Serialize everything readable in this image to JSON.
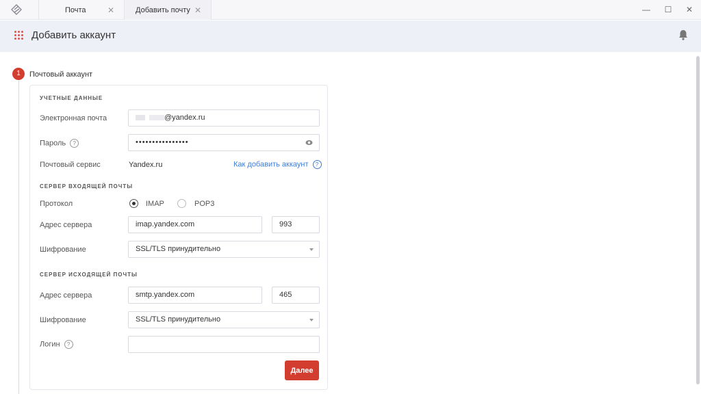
{
  "window": {
    "tabs": [
      {
        "label": "Почта",
        "close": "✕"
      },
      {
        "label": "Добавить почту",
        "close": "✕"
      }
    ],
    "controls": {
      "minimize": "—",
      "maximize": "☐",
      "close": "✕"
    }
  },
  "header": {
    "title": "Добавить аккаунт"
  },
  "step": {
    "number": "1",
    "title": "Почтовый аккаунт"
  },
  "credentials": {
    "section_title": "УЧЕТНЫЕ ДАННЫЕ",
    "email_label": "Электронная почта",
    "email_value_domain": "@yandex.ru",
    "password_label": "Пароль",
    "password_value": "••••••••••••••••",
    "service_label": "Почтовый сервис",
    "service_value": "Yandex.ru",
    "how_to_link": "Как добавить аккаунт"
  },
  "incoming": {
    "section_title": "СЕРВЕР ВХОДЯЩЕЙ ПОЧТЫ",
    "protocol_label": "Протокол",
    "protocol_options": [
      "IMAP",
      "POP3"
    ],
    "protocol_selected": "IMAP",
    "server_label": "Адрес сервера",
    "server_value": "imap.yandex.com",
    "port_value": "993",
    "encryption_label": "Шифрование",
    "encryption_value": "SSL/TLS принудительно"
  },
  "outgoing": {
    "section_title": "СЕРВЕР ИСХОДЯЩЕЙ ПОЧТЫ",
    "server_label": "Адрес сервера",
    "server_value": "smtp.yandex.com",
    "port_value": "465",
    "encryption_label": "Шифрование",
    "encryption_value": "SSL/TLS принудительно",
    "login_label": "Логин",
    "login_value": ""
  },
  "actions": {
    "next_label": "Далее"
  },
  "colors": {
    "accent": "#d23d30",
    "link": "#3a7bd5",
    "header_bg": "#eef0f7"
  },
  "icons": {
    "help": "?",
    "app_logo": "app-logo-icon",
    "grid": "grid-icon",
    "bell": "bell-icon",
    "eye": "eye-icon"
  }
}
